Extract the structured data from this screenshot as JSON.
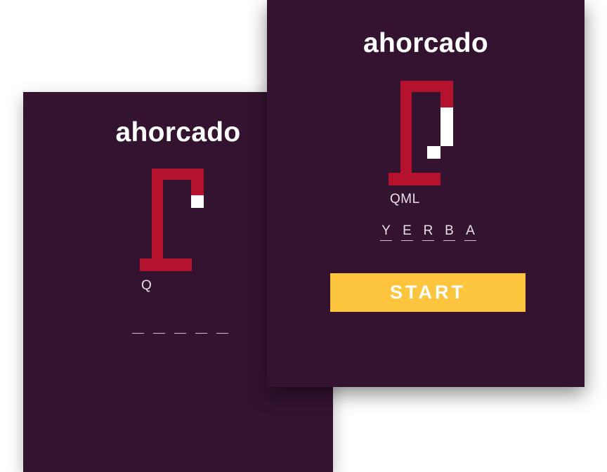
{
  "colors": {
    "background": "#341330",
    "gallows": "#b4122d",
    "figure": "#ffffff",
    "button": "#fdc43d"
  },
  "screen_back": {
    "title": "ahorcado",
    "guessed_letters": "Q",
    "word_slots": [
      "",
      "",
      "",
      "",
      ""
    ],
    "wrong_guesses": 1
  },
  "screen_front": {
    "title": "ahorcado",
    "guessed_letters": "QML",
    "word_slots": [
      "Y",
      "E",
      "R",
      "B",
      "A"
    ],
    "wrong_guesses": 3,
    "start_label": "START"
  }
}
